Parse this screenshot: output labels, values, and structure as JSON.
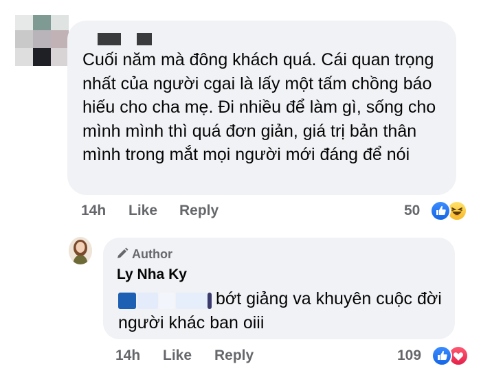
{
  "comment": {
    "text": "Cuối năm mà đông khách quá.  Cái quan trọng nhất của người cgai là lấy một tấm chồng báo hiếu cho cha mẹ.  Đi nhiều để làm gì,  sống cho mình mình thì quá đơn giản,  giá trị bản thân mình trong mắt mọi người mới đáng để nói",
    "time": "14h",
    "like_label": "Like",
    "reply_label": "Reply",
    "reaction_count": "50",
    "reactions": [
      "like-icon",
      "haha-icon"
    ]
  },
  "reply": {
    "author_badge": "Author",
    "name": "Ly Nha Ky",
    "text": "bớt giảng va khuyên cuộc đời người khác ban oiii",
    "time": "14h",
    "like_label": "Like",
    "reply_label": "Reply",
    "reaction_count": "109",
    "reactions": [
      "like-icon",
      "heart-icon"
    ]
  },
  "colors": {
    "bubble": "#f0f2f5",
    "meta_text": "#65676b",
    "like_blue": "#1877f2",
    "heart_red": "#f33e58",
    "haha_yellow": "#f7b928"
  }
}
